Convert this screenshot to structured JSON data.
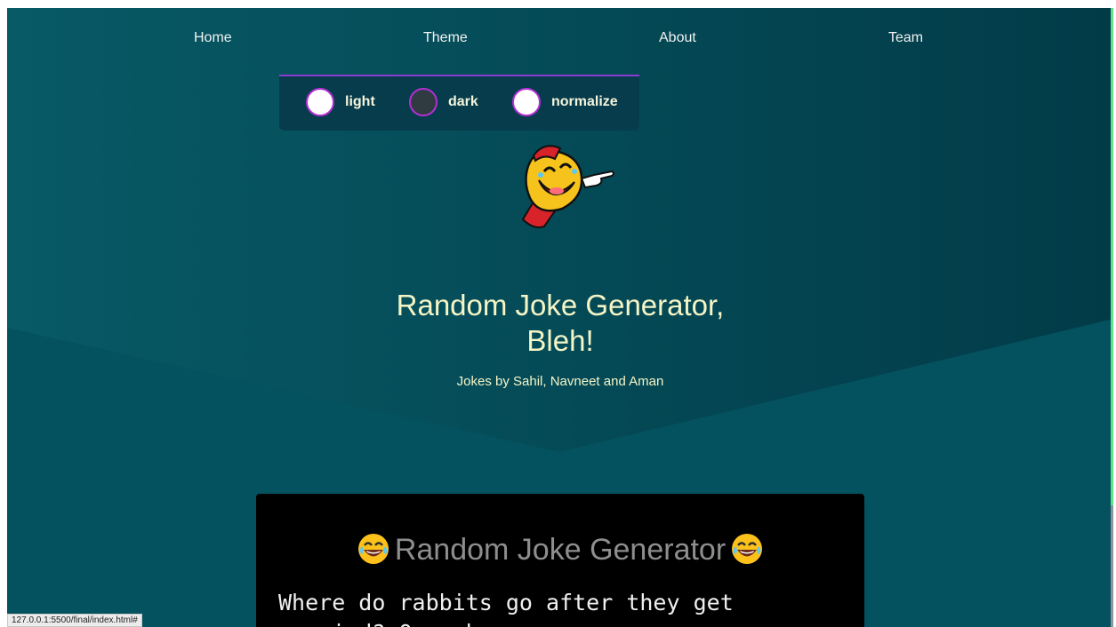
{
  "nav": {
    "items": [
      {
        "label": "Home"
      },
      {
        "label": "Theme"
      },
      {
        "label": "About"
      },
      {
        "label": "Team"
      }
    ]
  },
  "theme_menu": {
    "options": [
      {
        "label": "light",
        "swatch": "#ffffff"
      },
      {
        "label": "dark",
        "swatch": "#2f3b40"
      },
      {
        "label": "normalize",
        "swatch": "#ffffff"
      }
    ],
    "accent": "#8a3cd2"
  },
  "hero": {
    "title_line1": "Random Joke Generator,",
    "title_line2": "Bleh!",
    "subtitle": "Jokes by Sahil, Navneet and Aman"
  },
  "joke_card": {
    "heading": "Random Joke Generator",
    "joke": "Where do rabbits go after they get married? On a bunny-moon."
  },
  "status_bar": {
    "url": "127.0.0.1:5500/final/index.html#"
  },
  "colors": {
    "background": "#04525f",
    "hero_text": "#f5f5c6",
    "card_bg": "#000000"
  }
}
